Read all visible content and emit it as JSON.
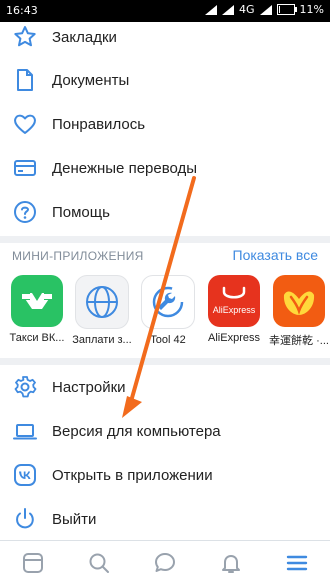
{
  "status": {
    "time": "16:43",
    "network": "4G",
    "battery": "11%",
    "battery_level": 0.11
  },
  "menu": {
    "bookmarks": "Закладки",
    "documents": "Документы",
    "liked": "Понравилось",
    "transfers": "Денежные переводы",
    "help": "Помощь"
  },
  "miniapps": {
    "title": "МИНИ-ПРИЛОЖЕНИЯ",
    "show_all": "Показать все",
    "items": [
      {
        "name": "Такси ВК...",
        "icon": "taxi-icon",
        "color": "#29c264"
      },
      {
        "name": "Заплати з...",
        "icon": "globe-icon",
        "color": "#f2f3f5"
      },
      {
        "name": "Tool 42",
        "icon": "wrench-icon",
        "color": "#ffffff"
      },
      {
        "name": "AliExpress",
        "icon": "aliexpress-icon",
        "color": "#e6331e"
      },
      {
        "name": "幸運餅乾 ·...",
        "icon": "fortune-cookie-icon",
        "color": "#f25c12"
      }
    ]
  },
  "menu2": {
    "settings": "Настройки",
    "desktop": "Версия для компьютера",
    "open_app": "Открыть в приложении",
    "logout": "Выйти"
  },
  "tabbar": {
    "items": [
      "news-icon",
      "search-icon",
      "messages-icon",
      "notifications-icon",
      "menu-icon"
    ],
    "active_color": "#3f8ae0",
    "inactive_color": "#99a2ad"
  },
  "colors": {
    "accent": "#3f8ae0",
    "annotation_arrow": "#f26b1d"
  },
  "ali_logo_text": "AliExpress"
}
